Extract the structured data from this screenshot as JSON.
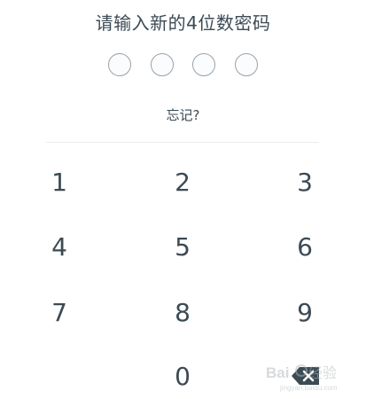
{
  "title": "请输入新的4位数密码",
  "pin": {
    "length": 4,
    "filled": 0
  },
  "forgot_label": "忘记?",
  "keypad": {
    "rows": [
      [
        "1",
        "2",
        "3"
      ],
      [
        "4",
        "5",
        "6"
      ],
      [
        "7",
        "8",
        "9"
      ],
      [
        "",
        "0",
        "backspace"
      ]
    ],
    "backspace_icon": "backspace-icon"
  },
  "watermark_logo": "Baidu 经验",
  "colors": {
    "text": "#3c4a54",
    "dot_border": "#9aa2a8",
    "divider": "#e8ecef"
  }
}
